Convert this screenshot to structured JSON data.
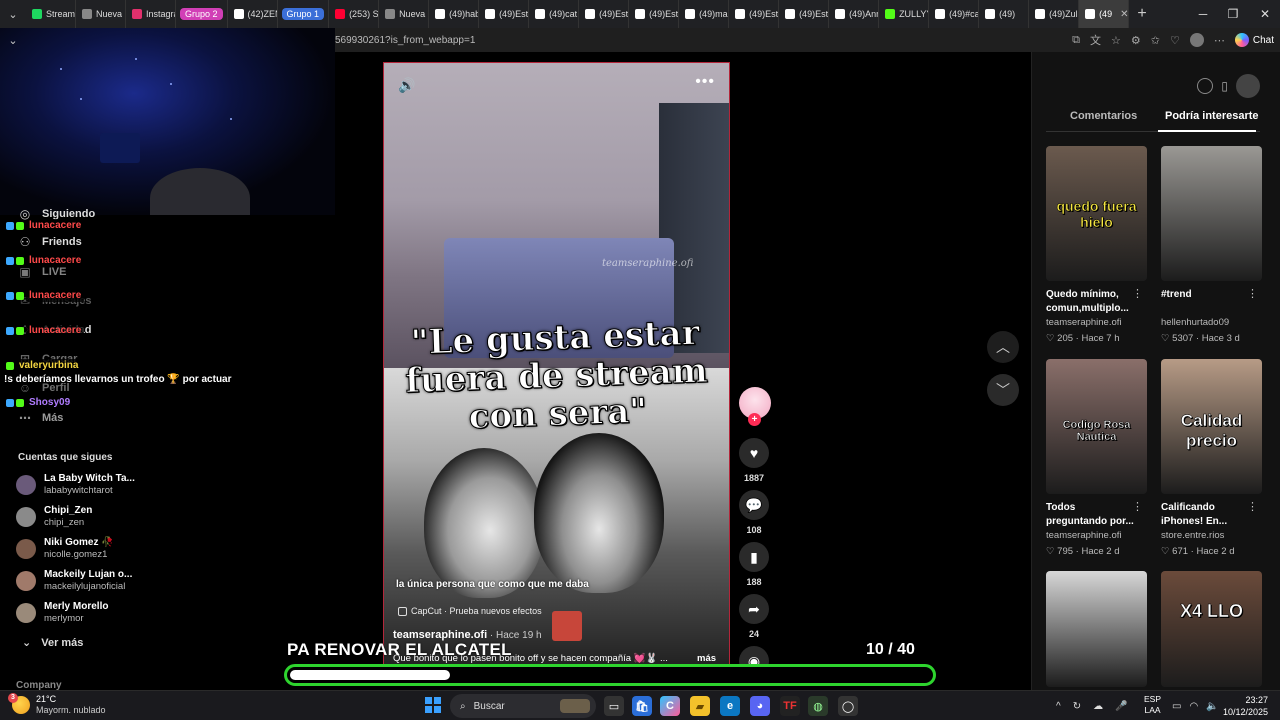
{
  "browser": {
    "tabs": [
      {
        "label": "Stream",
        "color": "#1ed760"
      },
      {
        "label": "Nueva p",
        "color": "#888888"
      },
      {
        "label": "Instagra",
        "color": "#e1306c"
      },
      {
        "label": "Grupo 2",
        "group": true,
        "color": "#d13fb6"
      },
      {
        "label": "(42)ZEN",
        "color": "#ffffff"
      },
      {
        "label": "Grupo 1",
        "group": true,
        "color": "#3b6fd8"
      },
      {
        "label": "(253) St",
        "color": "#ff0033"
      },
      {
        "label": "Nueva",
        "color": "#888888"
      },
      {
        "label": "(49)hab",
        "color": "#ffffff"
      },
      {
        "label": "(49)Esta",
        "color": "#ffffff"
      },
      {
        "label": "(49)cat",
        "color": "#ffffff"
      },
      {
        "label": "(49)Esta",
        "color": "#ffffff"
      },
      {
        "label": "(49)Esta",
        "color": "#ffffff"
      },
      {
        "label": "(49)mar",
        "color": "#ffffff"
      },
      {
        "label": "(49)Esta",
        "color": "#ffffff"
      },
      {
        "label": "(49)Esta",
        "color": "#ffffff"
      },
      {
        "label": "(49)Ann",
        "color": "#ffffff"
      },
      {
        "label": "ZULLYY",
        "color": "#53fc18"
      },
      {
        "label": "(49)#ca",
        "color": "#ffffff"
      },
      {
        "label": "(49)",
        "color": "#ffffff"
      },
      {
        "label": "(49)Zul",
        "color": "#ffffff"
      },
      {
        "label": "(49",
        "color": "#ffffff",
        "active": true
      }
    ],
    "url": "569930261?is_from_webapp=1",
    "copilot_label": "Chat"
  },
  "sidebar": {
    "nav": [
      {
        "label": "Siguiendo",
        "icon": "people-icon"
      },
      {
        "label": "Friends",
        "icon": "friends-icon"
      },
      {
        "label": "LIVE",
        "icon": "live-icon"
      },
      {
        "label": "Mensajes",
        "icon": "message-icon"
      },
      {
        "label": "Actividad",
        "icon": "activity-icon"
      },
      {
        "label": "Cargar",
        "icon": "upload-icon"
      },
      {
        "label": "Perfil",
        "icon": "profile-icon"
      },
      {
        "label": "Más",
        "icon": "more-icon"
      }
    ],
    "following_title": "Cuentas que sigues",
    "accounts": [
      {
        "name": "La Baby Witch Ta...",
        "handle": "lababywitchtarot"
      },
      {
        "name": "Chipi_Zen",
        "handle": "chipi_zen"
      },
      {
        "name": "Niki Gomez 🥀",
        "handle": "nicolle.gomez1"
      },
      {
        "name": "Mackeily Lujan o...",
        "handle": "mackeilylujanoficial"
      },
      {
        "name": "Merly Morello",
        "handle": "merlymor"
      }
    ],
    "see_more": "Ver más",
    "company": "Company"
  },
  "chat": {
    "lines": [
      {
        "name": "lunacacere",
        "color": "#ff4a4a"
      },
      {
        "name": "lunacacere",
        "color": "#ff4a4a"
      },
      {
        "name": "lunacacere",
        "color": "#ff4a4a"
      },
      {
        "name": "lunacacere",
        "color": "#ff4a4a"
      },
      {
        "name": "valeryurbina",
        "color": "#f5d742"
      },
      {
        "name": "Shosy09",
        "color": "#b07cff"
      }
    ],
    "message": "!s deberíamos llevarnos un trofeo 🏆 por actuar"
  },
  "video": {
    "headline": "\"Le gusta estar fuera de stream con sera\"",
    "watermark": "teamseraphine.ofi",
    "caption": "la única persona que como que me daba",
    "effect": "CapCut · Prueba nuevos efectos",
    "author": "teamseraphine.ofi",
    "meta": " · Hace 19 h",
    "description": "Que bonito que lo pasen bonito off y se hacen compañía 💓🐰 ...",
    "more": "más"
  },
  "actions": {
    "likes": "1887",
    "comments": "108",
    "saves": "188",
    "shares": "24"
  },
  "rightpanel": {
    "tab_comments": "Comentarios",
    "tab_interest": "Podría interesarte",
    "cards": [
      {
        "title": "Quedo mínimo, comun,multiplo...",
        "author": "teamseraphine.ofi",
        "likes": "205",
        "time": "Hace 7 h",
        "overlay": "quedo fuera hielo",
        "color": "#6b5a4e"
      },
      {
        "title": "#trend",
        "author": "hellenhurtado09",
        "likes": "5307",
        "time": "Hace 3 d",
        "overlay": "",
        "color": "#9a9894"
      },
      {
        "title": "Todos preguntando por...",
        "author": "teamseraphine.ofi",
        "likes": "795",
        "time": "Hace 2 d",
        "overlay": "Codigo Rosa Nautica",
        "color": "#8a6f6a"
      },
      {
        "title": "Calificando iPhones! En...",
        "author": "store.entre.rios",
        "likes": "671",
        "time": "Hace 2 d",
        "overlay": "Calidad precio",
        "color": "#b79b86"
      },
      {
        "title": "",
        "author": "",
        "likes": "",
        "time": "",
        "overlay": "",
        "color": "#d7d7d7"
      },
      {
        "title": "",
        "author": "",
        "likes": "",
        "time": "",
        "overlay": "X4 LLO",
        "color": "#6b4b3b"
      }
    ]
  },
  "overlay": {
    "text": "PA RENOVAR EL ALCATEL",
    "count": "10 / 40",
    "progress": 0.25,
    "bar_color": "#2ed42e"
  },
  "taskbar": {
    "temp": "21°C",
    "weather": "Mayorm. nublado",
    "notif": "3",
    "search": "Buscar",
    "lang1": "ESP",
    "lang2": "LAA",
    "time": "23:27",
    "date": "10/12/2025"
  }
}
